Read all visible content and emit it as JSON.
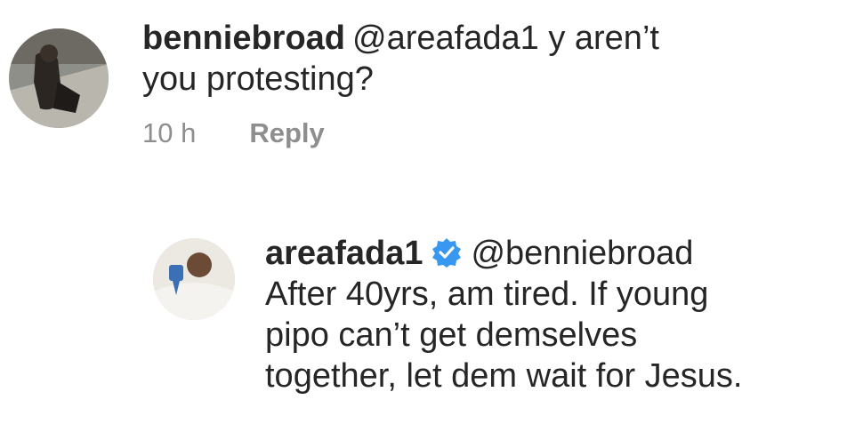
{
  "comments": [
    {
      "username": "benniebroad",
      "mention": "@areafada1",
      "text_lines": [
        "y aren’t",
        "you protesting?"
      ],
      "time": "10 h",
      "reply_label": "Reply"
    },
    {
      "username": "areafada1",
      "verified": true,
      "mention": "@benniebroad",
      "text_lines": [
        "After 40yrs, am tired. If young",
        "pipo can’t get demselves",
        "together, let dem wait for Jesus."
      ]
    }
  ],
  "colors": {
    "text": "#262626",
    "secondary": "#8e8e8e",
    "verified_badge": "#3897f0",
    "background": "#ffffff"
  },
  "icons": [
    "verified-badge-icon"
  ]
}
